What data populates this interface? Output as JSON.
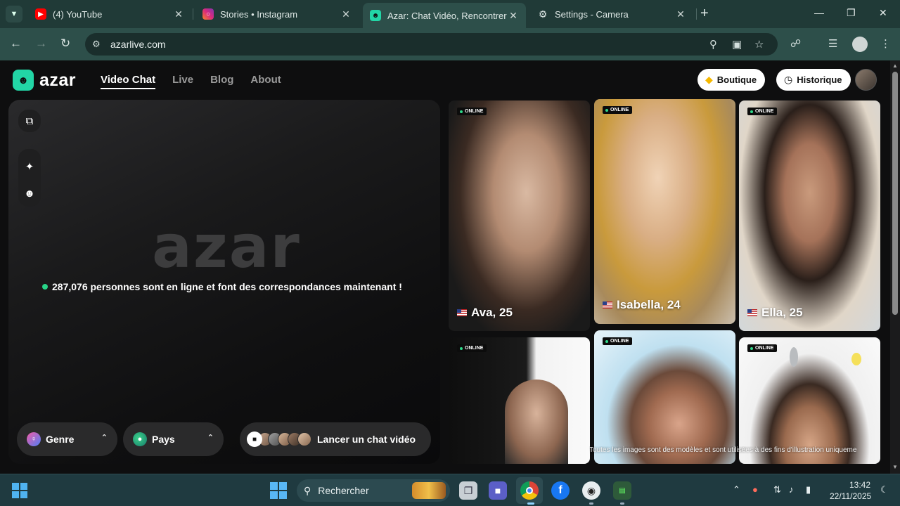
{
  "browser": {
    "tabs": [
      {
        "title": "(4) YouTube",
        "icon": "youtube-icon",
        "active": false
      },
      {
        "title": "Stories • Instagram",
        "icon": "instagram-icon",
        "active": false
      },
      {
        "title": "Azar: Chat Vidéo, Rencontrer de",
        "icon": "azar-icon",
        "active": true
      },
      {
        "title": "Settings - Camera",
        "icon": "gear-icon",
        "active": false
      }
    ],
    "url": "azarlive.com"
  },
  "site": {
    "logo_text": "azar",
    "nav": [
      "Video Chat",
      "Live",
      "Blog",
      "About"
    ],
    "boutique_label": "Boutique",
    "historique_label": "Historique",
    "big_logo": "azar",
    "online_text": "287,076 personnes sont en ligne et font des correspondances maintenant !",
    "genre_label": "Genre",
    "pays_label": "Pays",
    "launch_label": "Lancer un chat vidéo",
    "badge_label": "ONLINE",
    "profiles": [
      {
        "name": "Ava, 25"
      },
      {
        "name": "Isabella, 24"
      },
      {
        "name": "Ella, 25"
      },
      {
        "name": ""
      },
      {
        "name": ""
      },
      {
        "name": ""
      }
    ],
    "disclaimer": "Toutes les images sont des modèles et sont utilisées à des fins d'illustration uniquement"
  },
  "taskbar": {
    "search_placeholder": "Rechercher",
    "time": "13:42",
    "date": "22/11/2025"
  },
  "colors": {
    "accent": "#22d6a6",
    "online_dot": "#28d488",
    "tab_bar": "#203a37",
    "toolbar": "#2d4f4a"
  }
}
